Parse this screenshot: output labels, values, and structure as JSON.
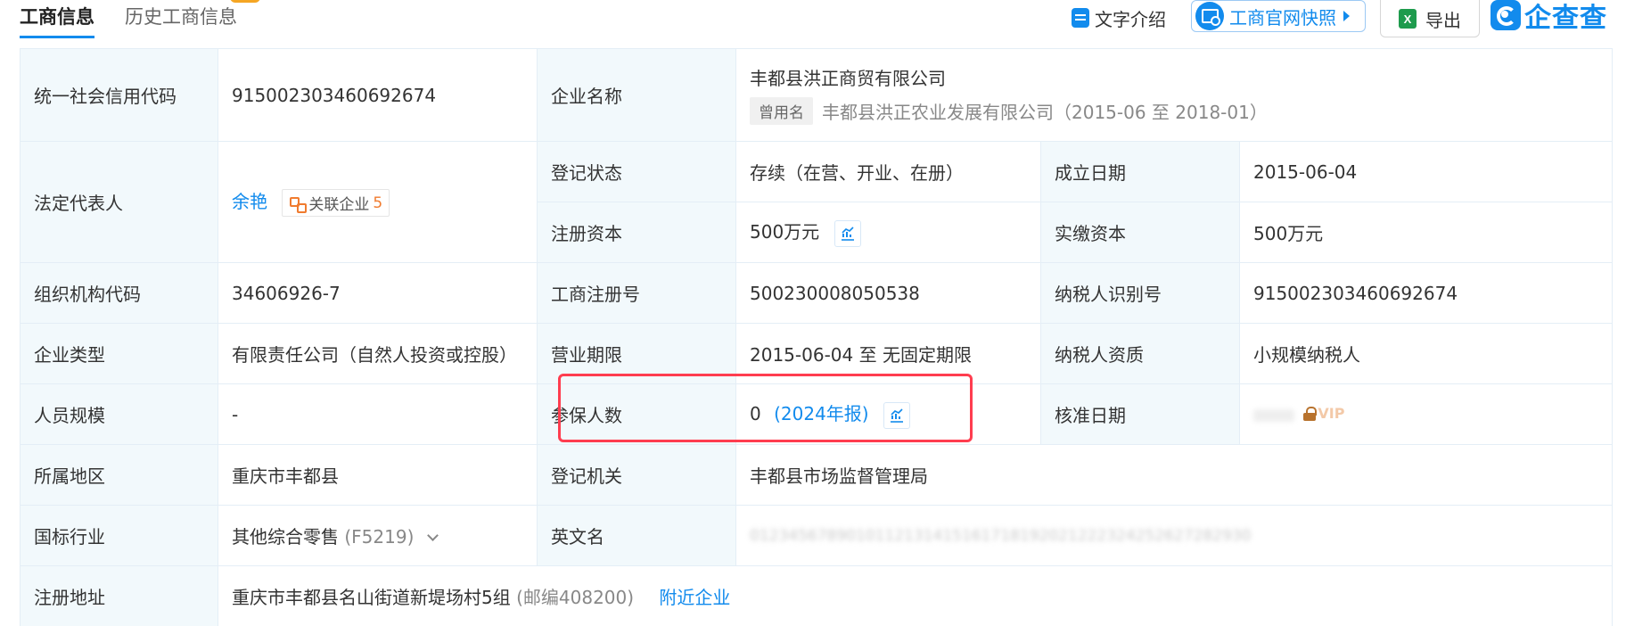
{
  "tabs": [
    {
      "label": "工商信息",
      "active": true
    },
    {
      "label": "历史工商信息",
      "active": false
    }
  ],
  "toolbar": {
    "text_intro": "文字介绍",
    "snapshot": "工商官网快照",
    "export": "导出",
    "excel_glyph": "X",
    "brand": "企查查"
  },
  "colors": {
    "accent": "#128bed",
    "highlight": "#ff3d4f",
    "badge_count": "#f07b2f"
  },
  "rows": {
    "credit_code": {
      "label": "统一社会信用代码",
      "value": "915002303460692674"
    },
    "company_name": {
      "label": "企业名称",
      "value": "丰都县洪正商贸有限公司",
      "former_tag": "曾用名",
      "former_value": "丰都县洪正农业发展有限公司（2015-06 至 2018-01）"
    },
    "legal_rep": {
      "label": "法定代表人",
      "value": "余艳",
      "assoc_label": "关联企业",
      "assoc_count": "5"
    },
    "reg_status": {
      "label": "登记状态",
      "value": "存续（在营、开业、在册）"
    },
    "found_date": {
      "label": "成立日期",
      "value": "2015-06-04"
    },
    "reg_capital": {
      "label": "注册资本",
      "value": "500万元"
    },
    "paid_capital": {
      "label": "实缴资本",
      "value": "500万元"
    },
    "org_code": {
      "label": "组织机构代码",
      "value": "34606926-7"
    },
    "biz_reg_no": {
      "label": "工商注册号",
      "value": "500230008050538"
    },
    "taxpayer_id": {
      "label": "纳税人识别号",
      "value": "915002303460692674"
    },
    "company_type": {
      "label": "企业类型",
      "value": "有限责任公司（自然人投资或控股）"
    },
    "biz_term": {
      "label": "营业期限",
      "value": "2015-06-04 至 无固定期限"
    },
    "taxpayer_qual": {
      "label": "纳税人资质",
      "value": "小规模纳税人"
    },
    "staff_size": {
      "label": "人员规模",
      "value": "-"
    },
    "insured": {
      "label": "参保人数",
      "value": "0",
      "year": "(2024年报)"
    },
    "approval_date": {
      "label": "核准日期",
      "vip": "VIP"
    },
    "region": {
      "label": "所属地区",
      "value": "重庆市丰都县"
    },
    "reg_authority": {
      "label": "登记机关",
      "value": "丰都县市场监督管理局"
    },
    "industry": {
      "label": "国标行业",
      "value": "其他综合零售",
      "code": "(F5219)"
    },
    "english_name": {
      "label": "英文名",
      "value": "0123456789010112131415161718192021222324252627282930"
    },
    "address": {
      "label": "注册地址",
      "value": "重庆市丰都县名山街道新堤场村5组",
      "postcode": "(邮编408200)",
      "nearby": "附近企业"
    }
  }
}
